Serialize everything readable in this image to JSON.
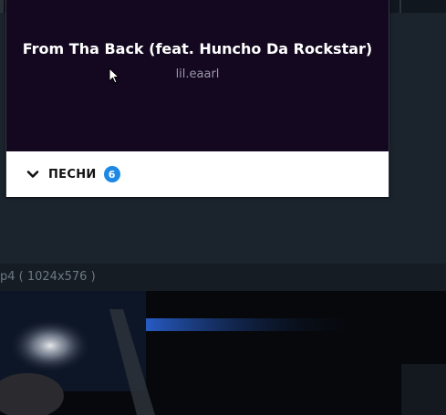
{
  "player": {
    "song_title": "From Tha Back (feat. Huncho Da Rockstar)",
    "artist": "lil.eaarl"
  },
  "songs_section": {
    "label": "ПЕСНИ",
    "count": "6",
    "toggle_icon": "chevron-down-icon"
  },
  "file_info": "p4 ( 1024x576 )",
  "colors": {
    "art_bg": "#130820",
    "badge": "#1e88e5",
    "page_bg": "#1b232c"
  }
}
